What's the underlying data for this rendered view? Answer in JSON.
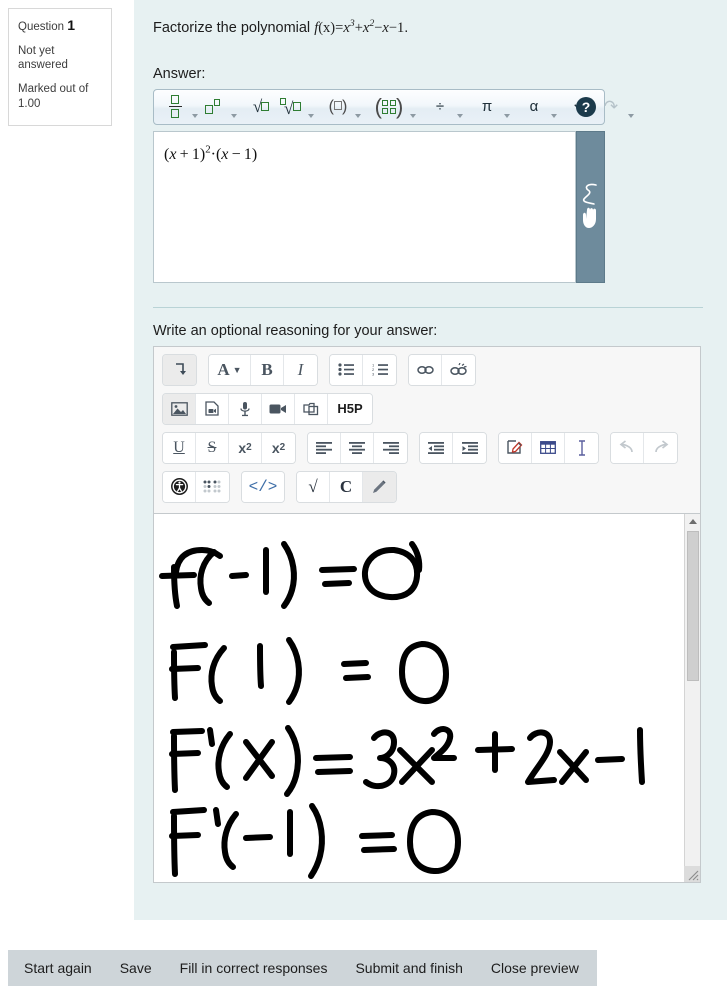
{
  "question_info": {
    "label": "Question",
    "number": "1",
    "state": "Not yet answered",
    "marks": "Marked out of 1.00"
  },
  "question": {
    "prompt_prefix": "Factorize the polynomial ",
    "fn": "f",
    "fn_arg": "(x)",
    "eq": "=",
    "term1_base": "x",
    "term1_exp": "3",
    "plus": "+",
    "term2_base": "x",
    "term2_exp": "2",
    "minus1": "−",
    "term3": "x",
    "minus2": "−",
    "term4": "1",
    "period": "."
  },
  "answer_section": {
    "label": "Answer:",
    "value": "(x + 1)² · (x − 1)",
    "value_parts": {
      "open": "(",
      "var": "x",
      "plus": "+",
      "one": "1",
      "close": ")",
      "exp": "2",
      "dot": "·",
      "open2": "(",
      "var2": "x",
      "minus": "−",
      "one2": "1",
      "close2": ")"
    },
    "drag_handle_icon": "scribble-hand-icon"
  },
  "math_toolbar": {
    "help_label": "?",
    "buttons": [
      {
        "name": "fraction-button",
        "glyph": "fraction",
        "has_caret": true
      },
      {
        "name": "superscript-button",
        "glyph": "power",
        "has_caret": true
      },
      {
        "name": "square-root-button",
        "glyph": "sqrt",
        "has_caret": false
      },
      {
        "name": "nth-root-button",
        "glyph": "nthroot",
        "has_caret": true
      },
      {
        "name": "parentheses-button",
        "glyph": "paren",
        "has_caret": true
      },
      {
        "name": "matrix-button",
        "glyph": "matrix",
        "has_caret": true
      },
      {
        "name": "division-button",
        "glyph": "÷",
        "has_caret": true
      },
      {
        "name": "pi-symbol-button",
        "glyph": "π",
        "has_caret": true
      },
      {
        "name": "greek-alpha-button",
        "glyph": "α",
        "has_caret": true
      },
      {
        "name": "undo-button",
        "glyph": "↶",
        "has_caret": false
      },
      {
        "name": "redo-button",
        "glyph": "↷",
        "has_caret": true
      }
    ]
  },
  "reasoning_section": {
    "label": "Write an optional reasoning for your answer:"
  },
  "editor_toolbar": {
    "rows": [
      {
        "groups": [
          {
            "buttons": [
              {
                "name": "expand-toolbar-button",
                "glyph": "⤵",
                "active": true
              }
            ]
          },
          {
            "buttons": [
              {
                "name": "font-style-button",
                "glyph": "A▾"
              },
              {
                "name": "bold-button",
                "glyph": "B"
              },
              {
                "name": "italic-button",
                "glyph": "I"
              }
            ]
          },
          {
            "buttons": [
              {
                "name": "bulleted-list-button",
                "glyph": "ul"
              },
              {
                "name": "numbered-list-button",
                "glyph": "ol"
              }
            ]
          },
          {
            "buttons": [
              {
                "name": "link-button",
                "glyph": "link"
              },
              {
                "name": "unlink-button",
                "glyph": "unlink"
              }
            ]
          }
        ]
      },
      {
        "groups": [
          {
            "buttons": [
              {
                "name": "insert-image-button",
                "glyph": "image",
                "active": true
              },
              {
                "name": "insert-media-file-button",
                "glyph": "mediafile"
              },
              {
                "name": "record-audio-button",
                "glyph": "microphone"
              },
              {
                "name": "record-video-button",
                "glyph": "videocam"
              },
              {
                "name": "manage-files-button",
                "glyph": "files"
              },
              {
                "name": "h5p-button",
                "glyph": "H5P"
              }
            ]
          }
        ]
      },
      {
        "groups": [
          {
            "buttons": [
              {
                "name": "underline-button",
                "glyph": "U"
              },
              {
                "name": "strikethrough-button",
                "glyph": "S"
              },
              {
                "name": "subscript-button",
                "glyph": "x2sub"
              },
              {
                "name": "superscript-button",
                "glyph": "x2sup"
              }
            ]
          },
          {
            "buttons": [
              {
                "name": "align-left-button",
                "glyph": "alignleft"
              },
              {
                "name": "align-center-button",
                "glyph": "aligncenter"
              },
              {
                "name": "align-right-button",
                "glyph": "alignright"
              }
            ]
          },
          {
            "buttons": [
              {
                "name": "outdent-button",
                "glyph": "outdent"
              },
              {
                "name": "indent-button",
                "glyph": "indent"
              }
            ]
          },
          {
            "buttons": [
              {
                "name": "edit-html-pencil-button",
                "glyph": "penbox"
              },
              {
                "name": "insert-table-button",
                "glyph": "table"
              },
              {
                "name": "clear-formatting-button",
                "glyph": "textcursor"
              }
            ]
          },
          {
            "buttons": [
              {
                "name": "undo-button",
                "glyph": "↺",
                "dim": true
              },
              {
                "name": "redo-button",
                "glyph": "↻",
                "dim": true
              }
            ]
          }
        ]
      },
      {
        "groups": [
          {
            "buttons": [
              {
                "name": "accessibility-checker-button",
                "glyph": "accessibility"
              },
              {
                "name": "screenreader-helper-button",
                "glyph": "braille",
                "dim": true
              }
            ]
          },
          {
            "buttons": [
              {
                "name": "html-source-button",
                "glyph": "</>"
              }
            ]
          },
          {
            "buttons": [
              {
                "name": "equation-editor-button",
                "glyph": "√"
              },
              {
                "name": "chemistry-editor-button",
                "glyph": "C"
              },
              {
                "name": "draw-button",
                "glyph": "pencil",
                "active": true
              }
            ]
          }
        ]
      }
    ]
  },
  "handwriting": {
    "lines": [
      "f(-1) = 0",
      "F(1) = 0",
      "F'(X) = 3x² + 2x - 1",
      "F'(-1) = 0"
    ]
  },
  "action_bar": {
    "buttons": [
      {
        "name": "start-again-button",
        "label": "Start again"
      },
      {
        "name": "save-button",
        "label": "Save"
      },
      {
        "name": "fill-correct-responses-button",
        "label": "Fill in correct responses"
      },
      {
        "name": "submit-and-finish-button",
        "label": "Submit and finish"
      },
      {
        "name": "close-preview-button",
        "label": "Close preview"
      }
    ]
  },
  "colors": {
    "panel_bg": "#e7f1f2",
    "handle_bg": "#6e8b9c",
    "action_bar_bg": "#ced5d9",
    "math_green": "#2e7d32"
  }
}
